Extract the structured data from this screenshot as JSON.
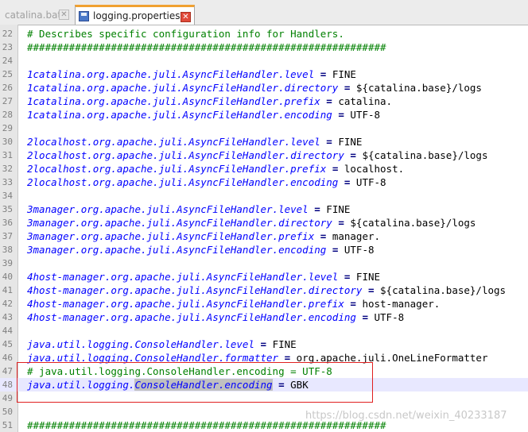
{
  "tabs": [
    {
      "label": "catalina.bat",
      "active": false
    },
    {
      "label": "logging.properties",
      "active": true
    }
  ],
  "lines": [
    {
      "n": "22",
      "segs": [
        {
          "t": "# Describes specific configuration info for Handlers.",
          "c": "comment"
        }
      ]
    },
    {
      "n": "23",
      "segs": [
        {
          "t": "############################################################",
          "c": "comment"
        }
      ]
    },
    {
      "n": "24",
      "segs": []
    },
    {
      "n": "25",
      "segs": [
        {
          "t": "1catalina.org.apache.juli.AsyncFileHandler.level",
          "c": "key"
        },
        {
          "t": " = ",
          "c": "op"
        },
        {
          "t": "FINE",
          "c": "val"
        }
      ]
    },
    {
      "n": "26",
      "segs": [
        {
          "t": "1catalina.org.apache.juli.AsyncFileHandler.directory",
          "c": "key"
        },
        {
          "t": " = ",
          "c": "op"
        },
        {
          "t": "${catalina.base}/logs",
          "c": "val"
        }
      ]
    },
    {
      "n": "27",
      "segs": [
        {
          "t": "1catalina.org.apache.juli.AsyncFileHandler.prefix",
          "c": "key"
        },
        {
          "t": " = ",
          "c": "op"
        },
        {
          "t": "catalina.",
          "c": "val"
        }
      ]
    },
    {
      "n": "28",
      "segs": [
        {
          "t": "1catalina.org.apache.juli.AsyncFileHandler.encoding",
          "c": "key"
        },
        {
          "t": " = ",
          "c": "op"
        },
        {
          "t": "UTF-8",
          "c": "val"
        }
      ]
    },
    {
      "n": "29",
      "segs": []
    },
    {
      "n": "30",
      "segs": [
        {
          "t": "2localhost.org.apache.juli.AsyncFileHandler.level",
          "c": "key"
        },
        {
          "t": " = ",
          "c": "op"
        },
        {
          "t": "FINE",
          "c": "val"
        }
      ]
    },
    {
      "n": "31",
      "segs": [
        {
          "t": "2localhost.org.apache.juli.AsyncFileHandler.directory",
          "c": "key"
        },
        {
          "t": " = ",
          "c": "op"
        },
        {
          "t": "${catalina.base}/logs",
          "c": "val"
        }
      ]
    },
    {
      "n": "32",
      "segs": [
        {
          "t": "2localhost.org.apache.juli.AsyncFileHandler.prefix",
          "c": "key"
        },
        {
          "t": " = ",
          "c": "op"
        },
        {
          "t": "localhost.",
          "c": "val"
        }
      ]
    },
    {
      "n": "33",
      "segs": [
        {
          "t": "2localhost.org.apache.juli.AsyncFileHandler.encoding",
          "c": "key"
        },
        {
          "t": " = ",
          "c": "op"
        },
        {
          "t": "UTF-8",
          "c": "val"
        }
      ]
    },
    {
      "n": "34",
      "segs": []
    },
    {
      "n": "35",
      "segs": [
        {
          "t": "3manager.org.apache.juli.AsyncFileHandler.level",
          "c": "key"
        },
        {
          "t": " = ",
          "c": "op"
        },
        {
          "t": "FINE",
          "c": "val"
        }
      ]
    },
    {
      "n": "36",
      "segs": [
        {
          "t": "3manager.org.apache.juli.AsyncFileHandler.directory",
          "c": "key"
        },
        {
          "t": " = ",
          "c": "op"
        },
        {
          "t": "${catalina.base}/logs",
          "c": "val"
        }
      ]
    },
    {
      "n": "37",
      "segs": [
        {
          "t": "3manager.org.apache.juli.AsyncFileHandler.prefix",
          "c": "key"
        },
        {
          "t": " = ",
          "c": "op"
        },
        {
          "t": "manager.",
          "c": "val"
        }
      ]
    },
    {
      "n": "38",
      "segs": [
        {
          "t": "3manager.org.apache.juli.AsyncFileHandler.encoding",
          "c": "key"
        },
        {
          "t": " = ",
          "c": "op"
        },
        {
          "t": "UTF-8",
          "c": "val"
        }
      ]
    },
    {
      "n": "39",
      "segs": []
    },
    {
      "n": "40",
      "segs": [
        {
          "t": "4host-manager.org.apache.juli.AsyncFileHandler.level",
          "c": "key"
        },
        {
          "t": " = ",
          "c": "op"
        },
        {
          "t": "FINE",
          "c": "val"
        }
      ]
    },
    {
      "n": "41",
      "segs": [
        {
          "t": "4host-manager.org.apache.juli.AsyncFileHandler.directory",
          "c": "key"
        },
        {
          "t": " = ",
          "c": "op"
        },
        {
          "t": "${catalina.base}/logs",
          "c": "val"
        }
      ]
    },
    {
      "n": "42",
      "segs": [
        {
          "t": "4host-manager.org.apache.juli.AsyncFileHandler.prefix",
          "c": "key"
        },
        {
          "t": " = ",
          "c": "op"
        },
        {
          "t": "host-manager.",
          "c": "val"
        }
      ]
    },
    {
      "n": "43",
      "segs": [
        {
          "t": "4host-manager.org.apache.juli.AsyncFileHandler.encoding",
          "c": "key"
        },
        {
          "t": " = ",
          "c": "op"
        },
        {
          "t": "UTF-8",
          "c": "val"
        }
      ]
    },
    {
      "n": "44",
      "segs": []
    },
    {
      "n": "45",
      "segs": [
        {
          "t": "java.util.logging.ConsoleHandler.level",
          "c": "key"
        },
        {
          "t": " = ",
          "c": "op"
        },
        {
          "t": "FINE",
          "c": "val"
        }
      ]
    },
    {
      "n": "46",
      "segs": [
        {
          "t": "java.util.logging.ConsoleHandler.formatter",
          "c": "key"
        },
        {
          "t": " = ",
          "c": "op"
        },
        {
          "t": "org.apache.juli.OneLineFormatter",
          "c": "val"
        }
      ]
    },
    {
      "n": "47",
      "segs": [
        {
          "t": "# java.util.logging.ConsoleHandler.encoding = UTF-8",
          "c": "comment"
        }
      ]
    },
    {
      "n": "48",
      "current": true,
      "segs": [
        {
          "t": "java.util.logging.",
          "c": "key"
        },
        {
          "t": "ConsoleHandler.encoding",
          "c": "key sel"
        },
        {
          "t": " = ",
          "c": "op"
        },
        {
          "t": "GBK",
          "c": "val"
        }
      ]
    },
    {
      "n": "49",
      "segs": []
    },
    {
      "n": "50",
      "segs": []
    },
    {
      "n": "51",
      "segs": [
        {
          "t": "############################################################",
          "c": "comment"
        }
      ]
    }
  ],
  "watermark": "https://blog.csdn.net/weixin_40233187"
}
